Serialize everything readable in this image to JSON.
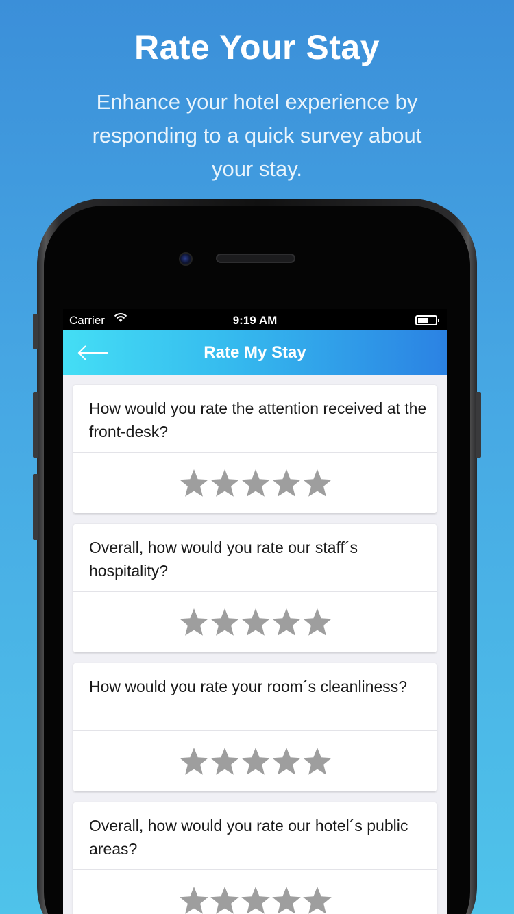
{
  "hero": {
    "title": "Rate Your Stay",
    "subtitle": "Enhance your hotel experience by responding to a quick survey about your stay."
  },
  "status_bar": {
    "carrier": "Carrier",
    "time": "9:19 AM",
    "wifi_icon": "wifi-icon",
    "battery_icon": "battery-icon"
  },
  "nav": {
    "back_icon": "arrow-left-icon",
    "title": "Rate My Stay"
  },
  "questions": [
    {
      "text": "How would you rate the attention received at the front-desk?",
      "rating": 0,
      "max": 5
    },
    {
      "text": "Overall, how would you rate our staff´s hospitality?",
      "rating": 0,
      "max": 5
    },
    {
      "text": "How would you rate your room´s cleanliness?",
      "rating": 0,
      "max": 5
    },
    {
      "text": "Overall, how would you rate our hotel´s public areas?",
      "rating": 0,
      "max": 5
    }
  ],
  "colors": {
    "background_top": "#3b8fd9",
    "background_bottom": "#4fc3ea",
    "nav_start": "#44def5",
    "nav_end": "#2b82e3",
    "star_empty": "#9e9e9e"
  }
}
